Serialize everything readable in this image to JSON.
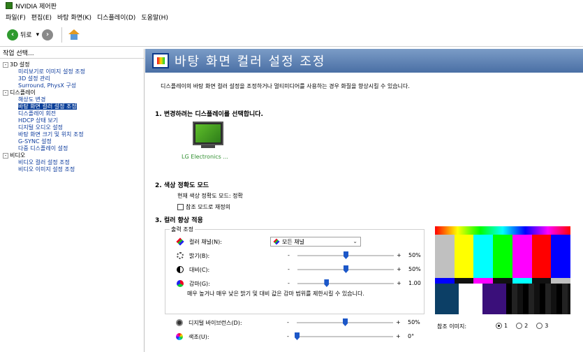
{
  "window": {
    "title": "NVIDIA 제어판"
  },
  "menu": [
    "파일(F)",
    "편집(E)",
    "바탕 화면(K)",
    "디스플레이(D)",
    "도움말(H)"
  ],
  "toolbar": {
    "back_label": "뒤로"
  },
  "left": {
    "task_header": "작업 선택...",
    "tree": [
      {
        "level": 0,
        "pm": "-",
        "label": "3D 설정"
      },
      {
        "level": 1,
        "label": "미리보기로 이미지 설정 조정"
      },
      {
        "level": 1,
        "label": "3D 설정 관리"
      },
      {
        "level": 1,
        "label": "Surround, PhysX 구성"
      },
      {
        "level": 0,
        "pm": "-",
        "label": "디스플레이"
      },
      {
        "level": 1,
        "label": "해상도 변경"
      },
      {
        "level": 1,
        "label": "바탕 화면 컬러 설정 조정",
        "selected": true
      },
      {
        "level": 1,
        "label": "디스플레이 회전"
      },
      {
        "level": 1,
        "label": "HDCP 상태 보기"
      },
      {
        "level": 1,
        "label": "디지털 오디오 설정"
      },
      {
        "level": 1,
        "label": "바탕 화면 크기 및 위치 조정"
      },
      {
        "level": 1,
        "label": "G-SYNC 설정"
      },
      {
        "level": 1,
        "label": "다중 디스플레이 설정"
      },
      {
        "level": 0,
        "pm": "-",
        "label": "비디오"
      },
      {
        "level": 1,
        "label": "비디오 컬러 설정 조정"
      },
      {
        "level": 1,
        "label": "비디오 이미지 설정 조정"
      }
    ]
  },
  "page": {
    "title": "바탕 화면 컬러 설정 조정",
    "description": "디스플레이의 바탕 화면 컬러 설정을 조정하거나 멀티미디어를 사용하는 경우 화질을 향상시킬 수 있습니다.",
    "section1": "1. 변경하려는 디스플레이를 선택합니다.",
    "display_name": "LG Electronics ...",
    "section2": "2. 색상 정확도 모드",
    "current_mode": "현재 색상 정확도 모드: 정확",
    "reset_label": "참조 모드로 재정의",
    "section3": "3. 컬러 향상 적용",
    "group_label": "출력 조정",
    "channel_label": "컬러 채널(N):",
    "channel_value": "모든 채널",
    "brightness_label": "밝기(B):",
    "brightness_value": "50%",
    "contrast_label": "대비(C):",
    "contrast_value": "50%",
    "gamma_label": "감마(G):",
    "gamma_value": "1.00",
    "note": "매우 높거나 매우 낮은 밝기 및 대비 값은 감마 범위를 제한시킬 수 있습니다.",
    "vibrance_label": "디지털 바이브런스(D):",
    "vibrance_value": "50%",
    "hue_label": "색조(U):",
    "hue_value": "0°",
    "ref_label": "참조 이미지:",
    "radios": [
      "1",
      "2",
      "3"
    ],
    "radio_selected": 0
  },
  "slider_levels": {
    "brightness_pct": 50,
    "contrast_pct": 50,
    "gamma_pct": 30,
    "vibrance_pct": 50,
    "hue_pct": 0
  },
  "colors": {
    "bars": [
      "#c0c0c0",
      "#ffff00",
      "#00ffff",
      "#00ff00",
      "#ff00ff",
      "#ff0000",
      "#0000ff"
    ],
    "mid": [
      "#0000ff",
      "#111111",
      "#ff00ff",
      "#111111",
      "#00ffff",
      "#111111",
      "#c0c0c0"
    ]
  }
}
